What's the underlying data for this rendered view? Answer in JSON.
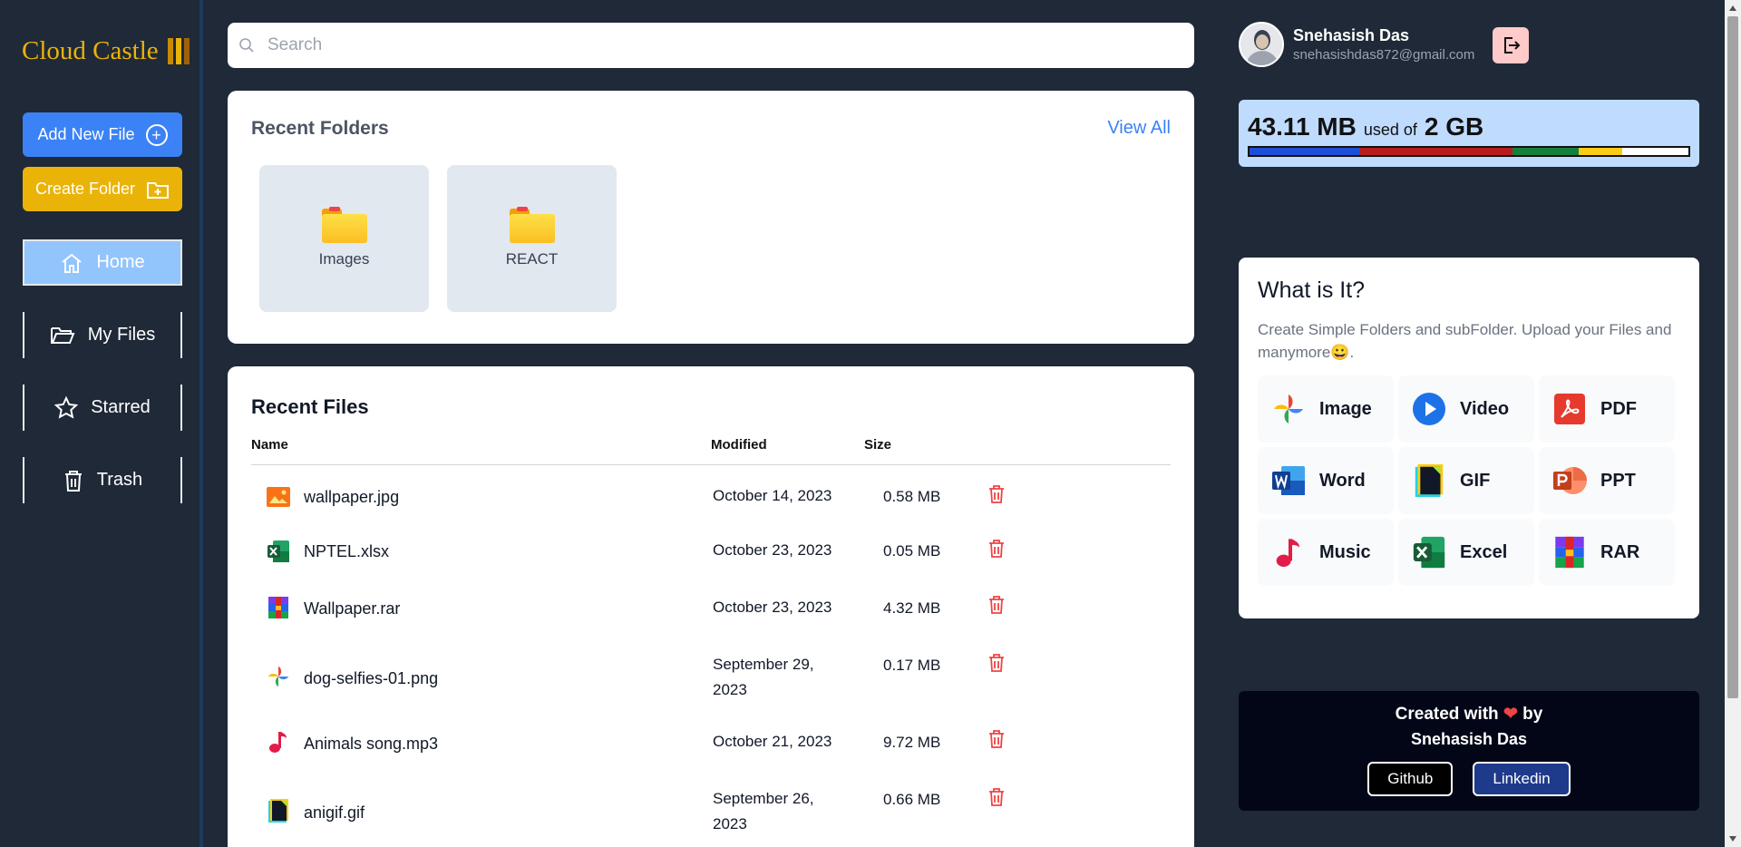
{
  "logo": {
    "text": "Cloud Castle"
  },
  "actions": {
    "add_file": "Add New File",
    "create_folder": "Create Folder"
  },
  "nav": {
    "home": "Home",
    "my_files": "My Files",
    "starred": "Starred",
    "trash": "Trash"
  },
  "search": {
    "placeholder": "Search"
  },
  "recent_folders": {
    "title": "Recent Folders",
    "view_all": "View All",
    "folders": [
      {
        "name": "Images"
      },
      {
        "name": "REACT"
      }
    ]
  },
  "recent_files": {
    "title": "Recent Files",
    "columns": {
      "name": "Name",
      "modified": "Modified",
      "size": "Size"
    },
    "files": [
      {
        "name": "wallpaper.jpg",
        "modified": "October 14, 2023",
        "size": "0.58 MB",
        "icon": "image-file-icon"
      },
      {
        "name": "NPTEL.xlsx",
        "modified": "October 23, 2023",
        "size": "0.05 MB",
        "icon": "excel-file-icon"
      },
      {
        "name": "Wallpaper.rar",
        "modified": "October 23, 2023",
        "size": "4.32 MB",
        "icon": "rar-file-icon"
      },
      {
        "name": "dog-selfies-01.png",
        "modified": "September 29, 2023",
        "size": "0.17 MB",
        "icon": "photos-pinwheel-icon"
      },
      {
        "name": "Animals song.mp3",
        "modified": "October 21, 2023",
        "size": "9.72 MB",
        "icon": "music-note-icon"
      },
      {
        "name": "anigif.gif",
        "modified": "September 26, 2023",
        "size": "0.66 MB",
        "icon": "gif-file-icon"
      }
    ]
  },
  "user": {
    "name": "Snehasish Das",
    "email": "snehasishdas872@gmail.com"
  },
  "storage": {
    "used": "43.11 MB",
    "used_of": "used of",
    "total": "2 GB",
    "segments": [
      {
        "fraction": 0.25,
        "color": "#1d4ed8"
      },
      {
        "fraction": 0.35,
        "color": "#b91c1c"
      },
      {
        "fraction": 0.15,
        "color": "#15803d"
      },
      {
        "fraction": 0.1,
        "color": "#facc15"
      },
      {
        "fraction": 0.15,
        "color": "#ffffff"
      }
    ]
  },
  "info": {
    "title": "What is It?",
    "description": "Create Simple Folders and subFolder. Upload your Files and manymore",
    "emoji": "😀",
    "types": [
      "Image",
      "Video",
      "PDF",
      "Word",
      "GIF",
      "PPT",
      "Music",
      "Excel",
      "RAR"
    ]
  },
  "credits": {
    "created_with": "Created with",
    "by": "by",
    "author": "Snehasish Das",
    "github": "Github",
    "linkedin": "Linkedin"
  },
  "colors": {
    "accent_blue": "#3b82f6",
    "accent_yellow": "#eab308",
    "sidebar_bg": "#1f2937",
    "danger": "#ef4444"
  }
}
